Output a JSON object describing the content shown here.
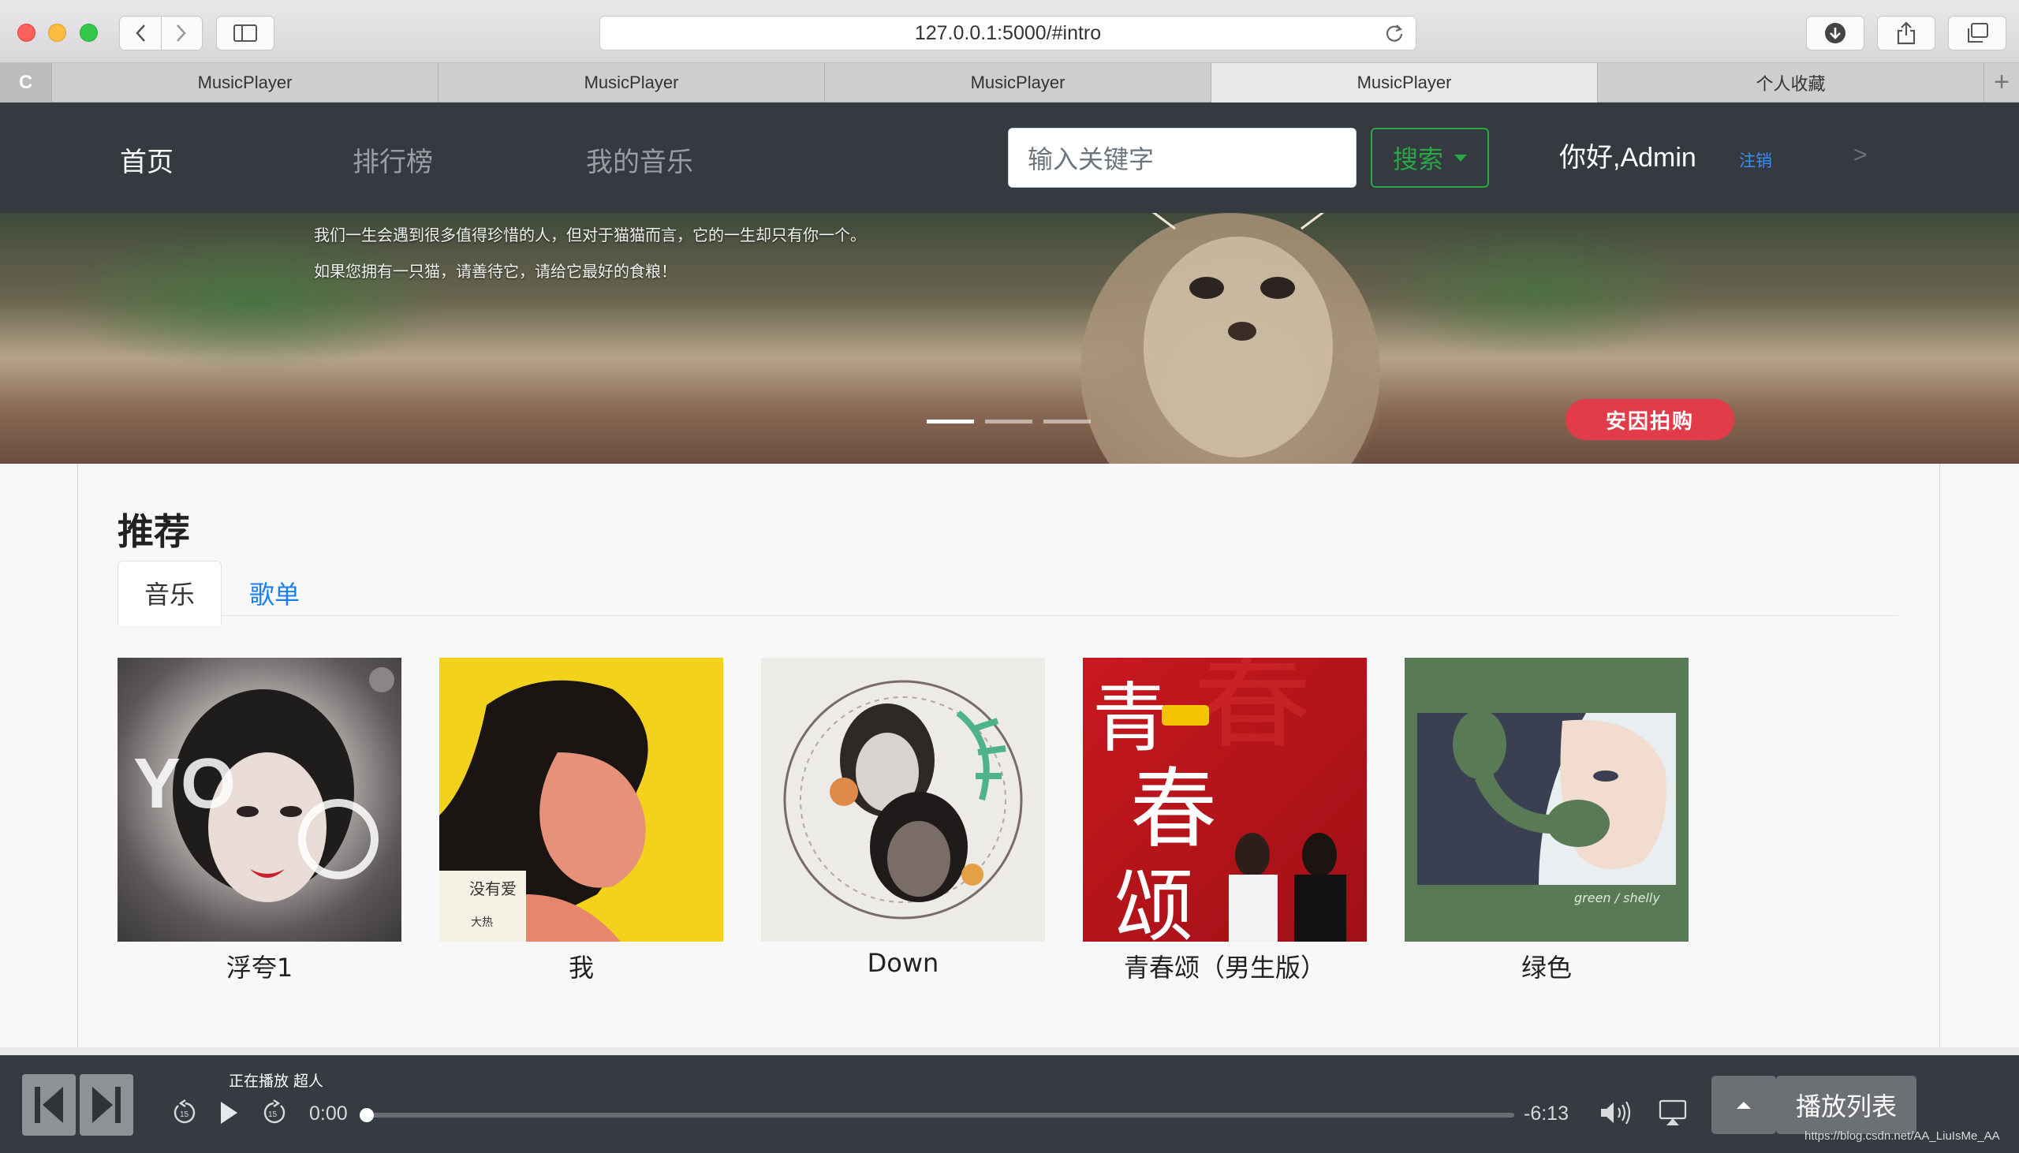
{
  "browser": {
    "url": "127.0.0.1:5000/#intro",
    "tabs": [
      {
        "label": "MusicPlayer",
        "active": false
      },
      {
        "label": "MusicPlayer",
        "active": false
      },
      {
        "label": "MusicPlayer",
        "active": false
      },
      {
        "label": "MusicPlayer",
        "active": true
      },
      {
        "label": "个人收藏",
        "active": false
      }
    ],
    "pinned_tab_letter": "C",
    "new_tab_label": "+"
  },
  "navbar": {
    "links": [
      {
        "label": "首页",
        "active": true
      },
      {
        "label": "排行榜",
        "active": false
      },
      {
        "label": "我的音乐",
        "active": false
      }
    ],
    "search_placeholder": "输入关键字",
    "search_button": "搜索",
    "greeting": "你好,Admin",
    "logout": "注销",
    "arrow": ">"
  },
  "banner": {
    "line1": "我们一生会遇到很多值得珍惜的人，但对于猫猫而言，它的一生却只有你一个。",
    "line2": "如果您拥有一只猫，请善待它，请给它最好的食粮！",
    "badge": "安因拍购",
    "slide_count": 3,
    "active_slide": 1
  },
  "recommend": {
    "title": "推荐",
    "tabs": [
      {
        "label": "音乐",
        "active": true
      },
      {
        "label": "歌单",
        "active": false
      }
    ],
    "albums": [
      {
        "title": "浮夸1",
        "cover": "portrait-woman-grey"
      },
      {
        "title": "我",
        "cover": "portrait-man-yellow"
      },
      {
        "title": "Down",
        "cover": "two-women-illustration"
      },
      {
        "title": "青春颂（男生版）",
        "cover": "red-calligraphy"
      },
      {
        "title": "绿色",
        "cover": "green-telephone-girl"
      }
    ]
  },
  "player": {
    "now_playing": "正在播放 超人",
    "current_time": "0:00",
    "remaining_time": "-6:13",
    "progress": 0.0,
    "playlist_button": "播放列表",
    "icons": [
      "skip-back-icon",
      "skip-forward-icon",
      "rewind-15-icon",
      "play-icon",
      "forward-15-icon",
      "volume-icon",
      "airplay-icon",
      "chevron-up-icon"
    ]
  },
  "watermark": "https://blog.csdn.net/AA_LiuIsMe_AA"
}
